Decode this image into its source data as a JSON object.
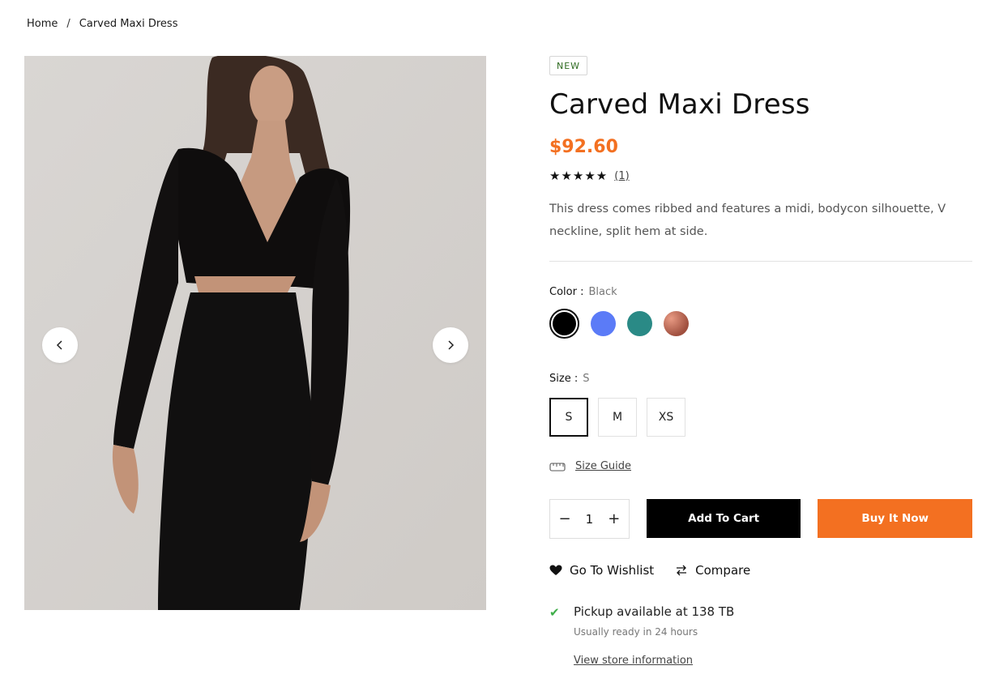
{
  "breadcrumb": {
    "home": "Home",
    "separator": "/",
    "current": "Carved Maxi Dress"
  },
  "product": {
    "badge": "NEW",
    "title": "Carved Maxi Dress",
    "price": "$92.60",
    "stars": "★★★★★",
    "rating": 5,
    "review_count": "(1)",
    "description": "This dress comes ribbed and features a midi, bodycon silhouette, V neckline, split hem at side."
  },
  "color": {
    "label": "Color :",
    "selected": "Black",
    "swatches": [
      "#000000",
      "#5b7bf7",
      "#2a8a86",
      "#a0503f"
    ]
  },
  "size": {
    "label": "Size :",
    "selected": "S",
    "options": [
      "S",
      "M",
      "XS"
    ]
  },
  "size_guide": {
    "label": "Size Guide",
    "icon": "ruler-icon"
  },
  "quantity": {
    "value": "1",
    "minus": "−",
    "plus": "+"
  },
  "buttons": {
    "add_to_cart": "Add To Cart",
    "buy_now": "Buy It Now"
  },
  "actions": {
    "wishlist": "Go To Wishlist",
    "compare": "Compare"
  },
  "pickup": {
    "main": "Pickup available at 138 TB",
    "sub": "Usually ready in 24 hours",
    "link": "View store information"
  },
  "colors": {
    "accent": "#f37021",
    "badge_text": "#2d6a1f",
    "check": "#3fae4a"
  }
}
